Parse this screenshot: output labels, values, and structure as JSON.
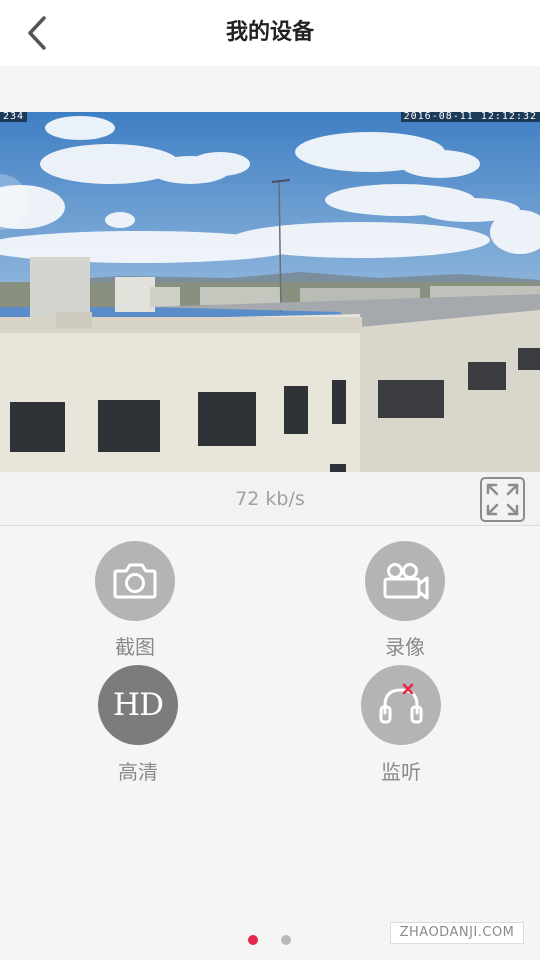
{
  "header": {
    "title": "我的设备"
  },
  "video": {
    "osd_left": "234",
    "osd_right": "2016-08-11  12:12:32"
  },
  "stream": {
    "speed": "72 kb/s"
  },
  "controls": {
    "screenshot_label": "截图",
    "record_label": "录像",
    "hd_label": "高清",
    "hd_icon_text": "HD",
    "listen_label": "监听"
  },
  "pager": {
    "active_index": 1,
    "count": 2
  },
  "watermark": "ZHAODANJI.COM",
  "colors": {
    "accent": "#e5264a",
    "button_light": "#b4b4b4",
    "button_dark": "#7c7c7c"
  },
  "icons": {
    "back": "chevron-left-icon",
    "fullscreen": "expand-icon",
    "screenshot": "camera-icon",
    "record": "video-camera-icon",
    "listen": "headphones-muted-icon"
  }
}
